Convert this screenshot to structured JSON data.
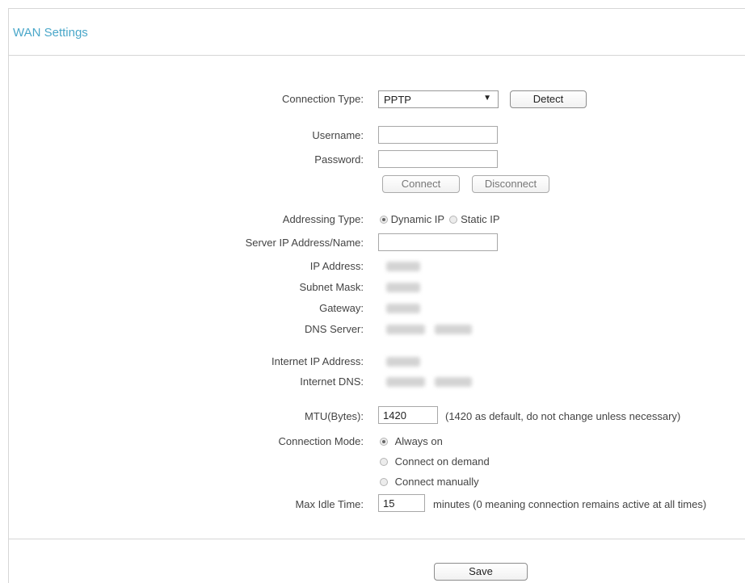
{
  "section_title": "WAN Settings",
  "connection_type": {
    "label": "Connection Type:",
    "value": "PPTP",
    "detect_label": "Detect"
  },
  "username": {
    "label": "Username:",
    "value": ""
  },
  "password": {
    "label": "Password:",
    "value": ""
  },
  "connect_label": "Connect",
  "disconnect_label": "Disconnect",
  "addressing": {
    "label": "Addressing Type:",
    "options": [
      "Dynamic IP",
      "Static IP"
    ],
    "selected": "Dynamic IP"
  },
  "server": {
    "label": "Server IP Address/Name:",
    "value": ""
  },
  "info": {
    "ip_label": "IP Address:",
    "subnet_label": "Subnet Mask:",
    "gateway_label": "Gateway:",
    "dns_label": "DNS Server:",
    "internet_ip_label": "Internet IP Address:",
    "internet_dns_label": "Internet DNS:"
  },
  "mtu": {
    "label": "MTU(Bytes):",
    "value": "1420",
    "hint": "(1420 as default, do not change unless necessary)"
  },
  "mode": {
    "label": "Connection Mode:",
    "options": [
      "Always on",
      "Connect on demand",
      "Connect manually"
    ],
    "selected": "Always on"
  },
  "idle": {
    "label": "Max Idle Time:",
    "value": "15",
    "hint": "minutes (0 meaning connection remains active at all times)"
  },
  "save_label": "Save"
}
